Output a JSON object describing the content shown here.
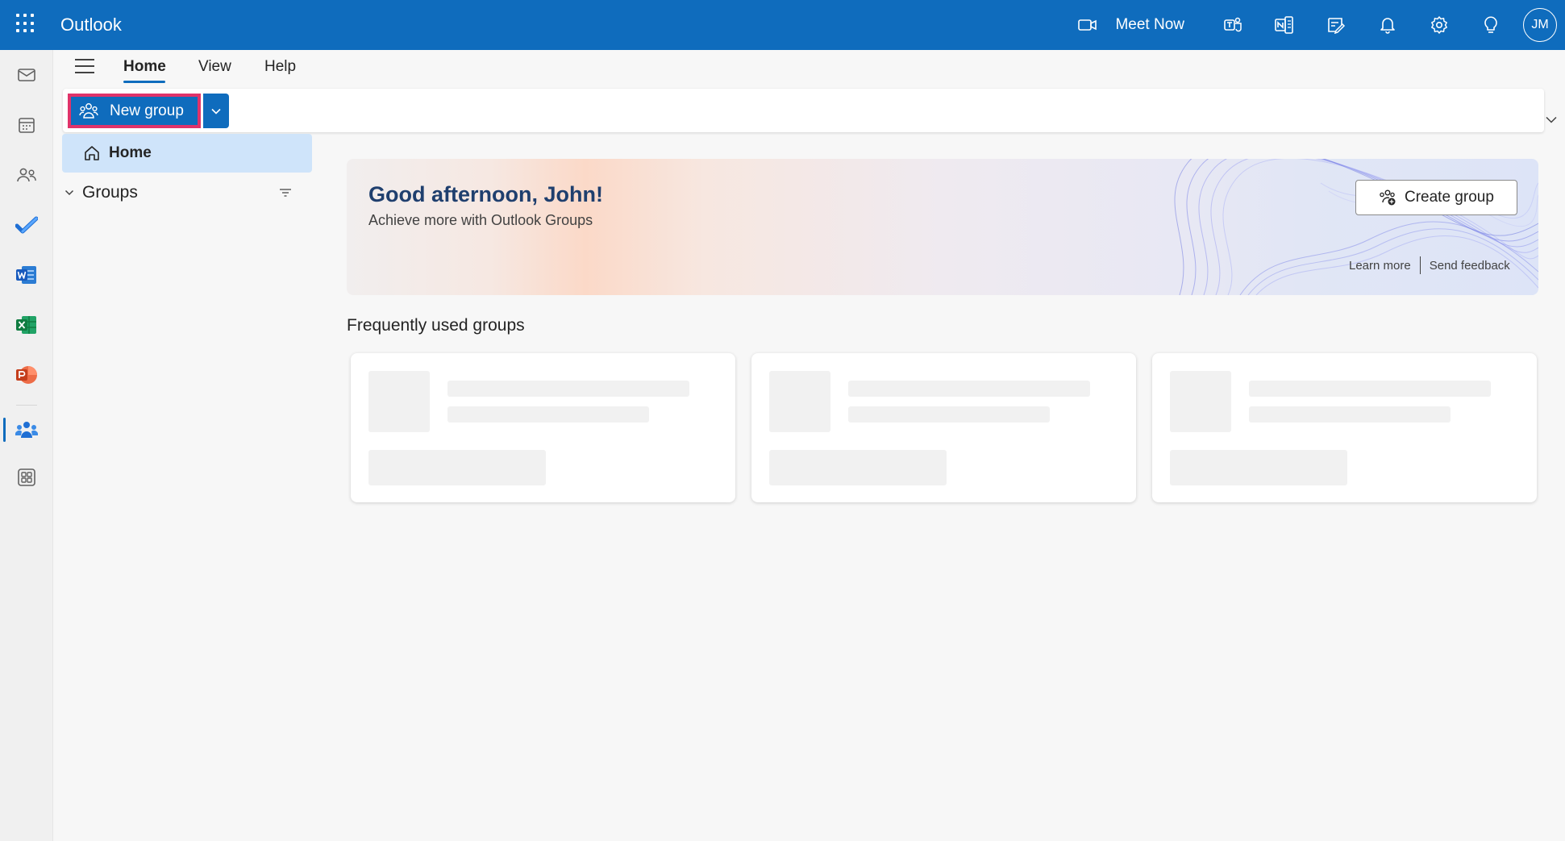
{
  "header": {
    "app_name": "Outlook",
    "meet_now": "Meet Now",
    "avatar_initials": "JM",
    "brand_color": "#0f6cbd"
  },
  "ribbon": {
    "tabs": [
      {
        "label": "Home",
        "active": true
      },
      {
        "label": "View",
        "active": false
      },
      {
        "label": "Help",
        "active": false
      }
    ],
    "new_group_label": "New group"
  },
  "nav": {
    "home_label": "Home",
    "groups_label": "Groups"
  },
  "banner": {
    "greeting": "Good afternoon, John!",
    "subtitle": "Achieve more with Outlook Groups",
    "create_group_label": "Create group",
    "learn_more": "Learn more",
    "send_feedback": "Send feedback"
  },
  "main": {
    "section_title": "Frequently used groups"
  },
  "icons": {
    "rail": [
      "mail-icon",
      "calendar-icon",
      "people-icon",
      "todo-icon",
      "word-icon",
      "excel-icon",
      "powerpoint-icon",
      "groups-icon",
      "more-apps-icon"
    ],
    "top": [
      "video-icon",
      "teams-icon",
      "onenote-icon",
      "notes-icon",
      "bell-icon",
      "gear-icon",
      "lightbulb-icon"
    ]
  }
}
